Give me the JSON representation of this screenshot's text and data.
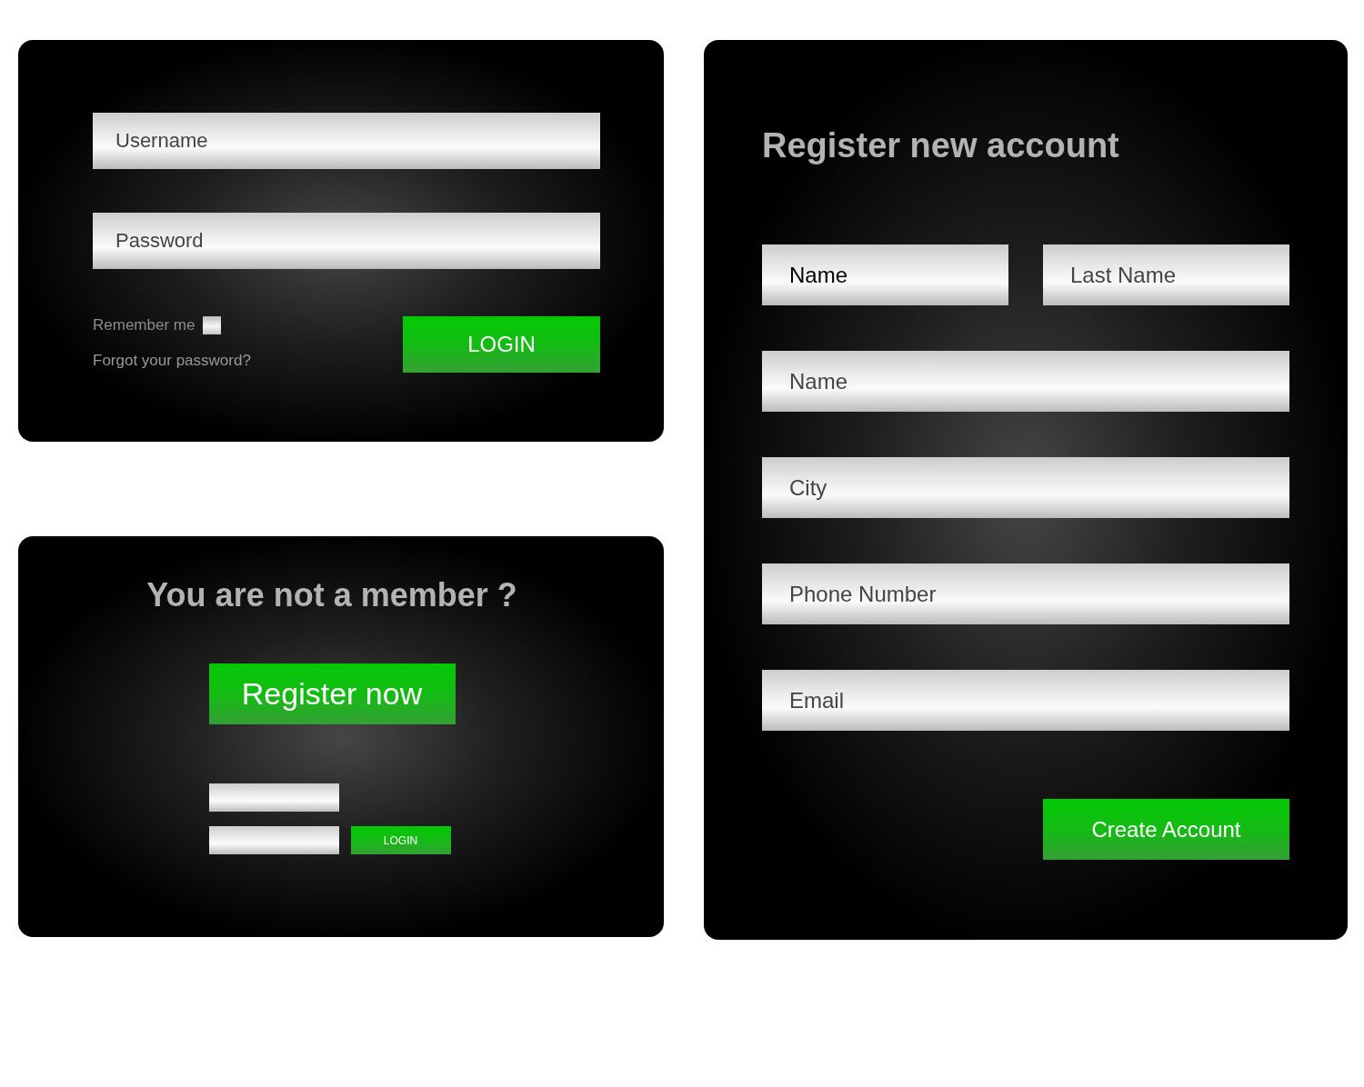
{
  "login": {
    "fields": [
      {
        "placeholder": "Username"
      },
      {
        "placeholder": "Password"
      }
    ],
    "remember": {
      "label": "Remember me",
      "checked": false
    },
    "forgot_link": "Forgot your password?",
    "button": "LOGIN"
  },
  "member": {
    "heading": "You are not a member ?",
    "register_button": "Register now",
    "quick_login": {
      "button": "LOGIN"
    }
  },
  "register": {
    "title": "Register new account",
    "name_row": [
      {
        "value": "Name"
      },
      {
        "placeholder": "Last Name"
      }
    ],
    "fields": [
      {
        "placeholder": "Name"
      },
      {
        "placeholder": "City"
      },
      {
        "placeholder": "Phone Number"
      },
      {
        "placeholder": "Email"
      }
    ],
    "button": "Create Account"
  }
}
